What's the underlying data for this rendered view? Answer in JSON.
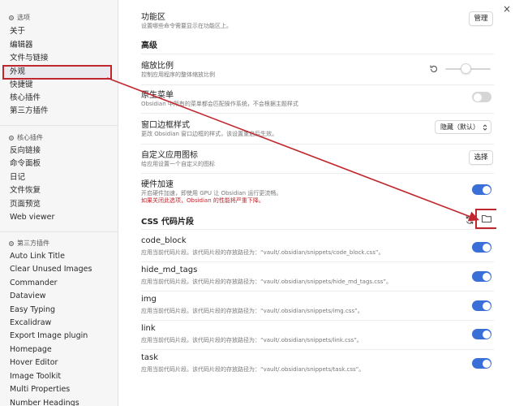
{
  "window": {
    "close_icon": "×"
  },
  "sidebar": {
    "sections": [
      {
        "label": "选项",
        "icon": "gear-icon"
      },
      {
        "label": "核心插件",
        "icon": "gear-icon"
      },
      {
        "label": "第三方插件",
        "icon": "gear-icon"
      }
    ],
    "options": [
      "关于",
      "编辑器",
      "文件与链接",
      "外观",
      "快捷键",
      "核心插件",
      "第三方插件"
    ],
    "core_plugins": [
      "反向链接",
      "命令面板",
      "日记",
      "文件恢复",
      "页面预览",
      "Web viewer"
    ],
    "community_plugins": [
      "Auto Link Title",
      "Clear Unused Images",
      "Commander",
      "Dataview",
      "Easy Typing",
      "Excalidraw",
      "Export Image plugin",
      "Homepage",
      "Hover Editor",
      "Image Toolkit",
      "Multi Properties",
      "Number Headings"
    ],
    "active_item": "外观"
  },
  "settings": {
    "ribbon": {
      "title": "功能区",
      "desc": "设置哪些命令需要显示在功能区上。",
      "button": "管理"
    },
    "advanced_heading": "高级",
    "zoom": {
      "title": "缩放比例",
      "desc": "控制应用程序的整体缩放比例",
      "value": 0.45,
      "reset_icon": "reset-icon"
    },
    "native_menu": {
      "title": "原生菜单",
      "desc": "Obsidian 中所有的菜单都会匹配操作系统，不会根据主题样式",
      "enabled": false
    },
    "frame_style": {
      "title": "窗口边框样式",
      "desc": "更改 Obsidian 窗口边框的样式，该设置重启后生效。",
      "selected": "隐藏（默认）"
    },
    "custom_icon": {
      "title": "自定义应用图标",
      "desc": "给应用设置一个自定义的图标",
      "button": "选择"
    },
    "hw_accel": {
      "title": "硬件加速",
      "desc": "开启硬件加速，即使用 GPU 让 Obsidian 运行更流畅。",
      "warning": "如果关闭此选项，Obsidian 的性能将严重下降。",
      "enabled": true
    }
  },
  "snippets": {
    "heading": "CSS 代码片段",
    "reload_icon": "reload-icon",
    "folder_icon": "folder-icon",
    "items": [
      {
        "name": "code_block",
        "desc": "应用当前代码片段。该代码片段的存放路径为：“vault/.obsidian/snippets/code_block.css”。",
        "enabled": true
      },
      {
        "name": "hide_md_tags",
        "desc": "应用当前代码片段。该代码片段的存放路径为：“vault/.obsidian/snippets/hide_md_tags.css”。",
        "enabled": true
      },
      {
        "name": "img",
        "desc": "应用当前代码片段。该代码片段的存放路径为：“vault/.obsidian/snippets/img.css”。",
        "enabled": true
      },
      {
        "name": "link",
        "desc": "应用当前代码片段。该代码片段的存放路径为：“vault/.obsidian/snippets/link.css”。",
        "enabled": true
      },
      {
        "name": "task",
        "desc": "应用当前代码片段。该代码片段的存放路径为：“vault/.obsidian/snippets/task.css”。",
        "enabled": true
      }
    ]
  },
  "colors": {
    "accent": "#3b6fd8",
    "annotation": "#c0262d",
    "warning": "#c0262d"
  }
}
